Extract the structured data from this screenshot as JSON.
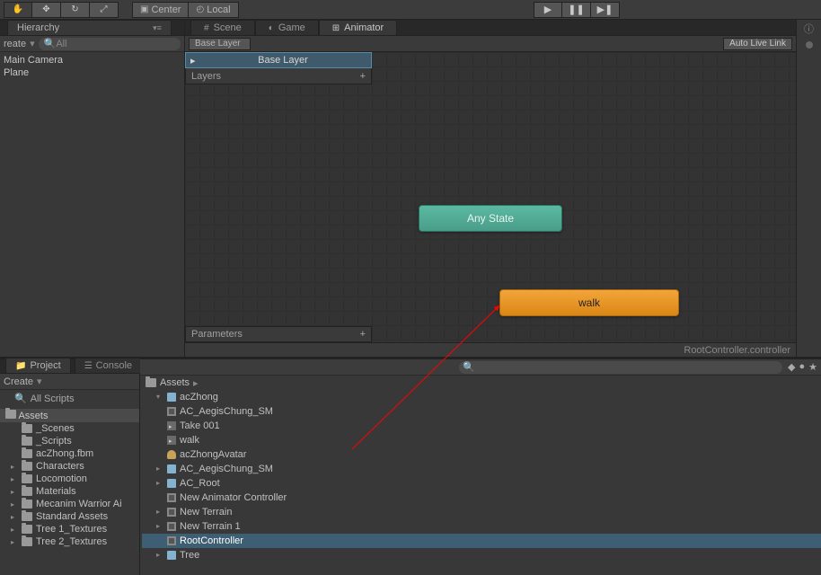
{
  "toolbar": {
    "center": "Center",
    "local": "Local"
  },
  "hierarchy": {
    "title": "Hierarchy",
    "create": "reate",
    "search_placeholder": "All",
    "items": [
      "Main Camera",
      "Plane"
    ],
    "options": "▾≡"
  },
  "tabs": {
    "scene": "Scene",
    "game": "Game",
    "animator": "Animator"
  },
  "animator": {
    "breadcrumb": "Base Layer",
    "auto_live": "Auto Live Link",
    "layer_item": "Base Layer",
    "layers_header": "Layers",
    "parameters_header": "Parameters",
    "any_state": "Any State",
    "walk_state": "walk",
    "footer_file": "RootController.controller"
  },
  "project": {
    "tab_project": "Project",
    "tab_console": "Console",
    "create": "Create",
    "fav_all_scripts": "All Scripts",
    "assets_header": "Assets",
    "folders": [
      "_Scenes",
      "_Scripts",
      "acZhong.fbm",
      "Characters",
      "Locomotion",
      "Materials",
      "Mecanim Warrior Ai",
      "Standard Assets",
      "Tree 1_Textures",
      "Tree 2_Textures"
    ],
    "crumb": "Assets",
    "list": {
      "aczhong": "acZhong",
      "ac_aegis_sm": "AC_AegisChung_SM",
      "take001": "Take 001",
      "walk": "walk",
      "avatar": "acZhongAvatar",
      "ac_aegis_sm2": "AC_AegisChung_SM",
      "ac_root": "AC_Root",
      "new_anim_ctrl": "New Animator Controller",
      "new_terrain": "New Terrain",
      "new_terrain1": "New Terrain 1",
      "root_ctrl": "RootController",
      "tree": "Tree"
    }
  }
}
